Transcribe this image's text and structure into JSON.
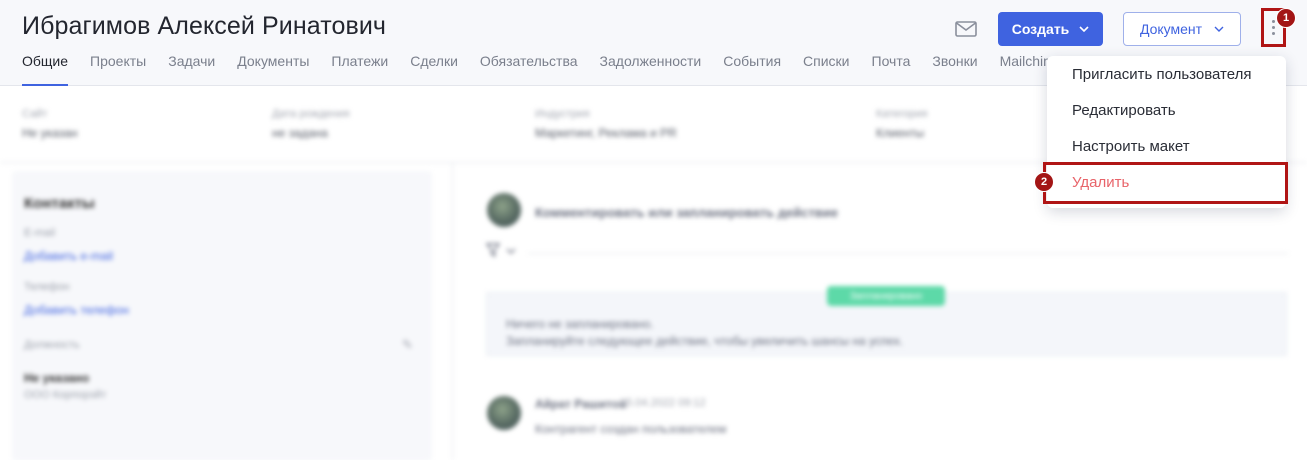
{
  "header": {
    "title": "Ибрагимов Алексей Ринатович",
    "create_label": "Создать",
    "document_label": "Документ",
    "mail_icon": "mail-icon",
    "kebab_icon": "more-vertical-icon"
  },
  "tabs": [
    {
      "label": "Общие",
      "active": true
    },
    {
      "label": "Проекты"
    },
    {
      "label": "Задачи"
    },
    {
      "label": "Документы"
    },
    {
      "label": "Платежи"
    },
    {
      "label": "Сделки"
    },
    {
      "label": "Обязательства"
    },
    {
      "label": "Задолженности"
    },
    {
      "label": "События"
    },
    {
      "label": "Списки"
    },
    {
      "label": "Почта"
    },
    {
      "label": "Звонки"
    },
    {
      "label": "Mailchimp"
    }
  ],
  "info": [
    {
      "label": "Сайт",
      "value": "Не указан"
    },
    {
      "label": "Дата рождения",
      "value": "не задана"
    },
    {
      "label": "Индустрия",
      "value": "Маркетинг, Реклама и PR"
    },
    {
      "label": "Категория",
      "value": "Клиенты"
    }
  ],
  "contacts": {
    "title": "Контакты",
    "email_label": "E-mail",
    "email_link": "Добавить e-mail",
    "phone_label": "Телефон",
    "phone_link": "Добавить телефон",
    "position_label": "Должность",
    "position_value": "Не указано",
    "company": "ООО Корпорэйт"
  },
  "feed": {
    "comment_prompt": "Комментировать или запланировать действие",
    "plan_badge": "Запланировано",
    "plan_line1": "Ничего не запланировано.",
    "plan_line2": "Запланируйте следующее действие, чтобы увеличить шансы на успех.",
    "entry_author": "Айрат Рашитов",
    "entry_date": "05.04.2022 09:12",
    "entry_text": "Контрагент создан пользователем"
  },
  "menu": {
    "items": [
      {
        "label": "Пригласить пользователя"
      },
      {
        "label": "Редактировать"
      },
      {
        "label": "Настроить макет"
      },
      {
        "label": "Удалить",
        "danger": true
      }
    ]
  },
  "markers": [
    "1",
    "2"
  ],
  "colors": {
    "accent": "#3f63e0",
    "danger": "#e8646a",
    "highlight": "#b01515",
    "badge": "#5dd9a8"
  }
}
